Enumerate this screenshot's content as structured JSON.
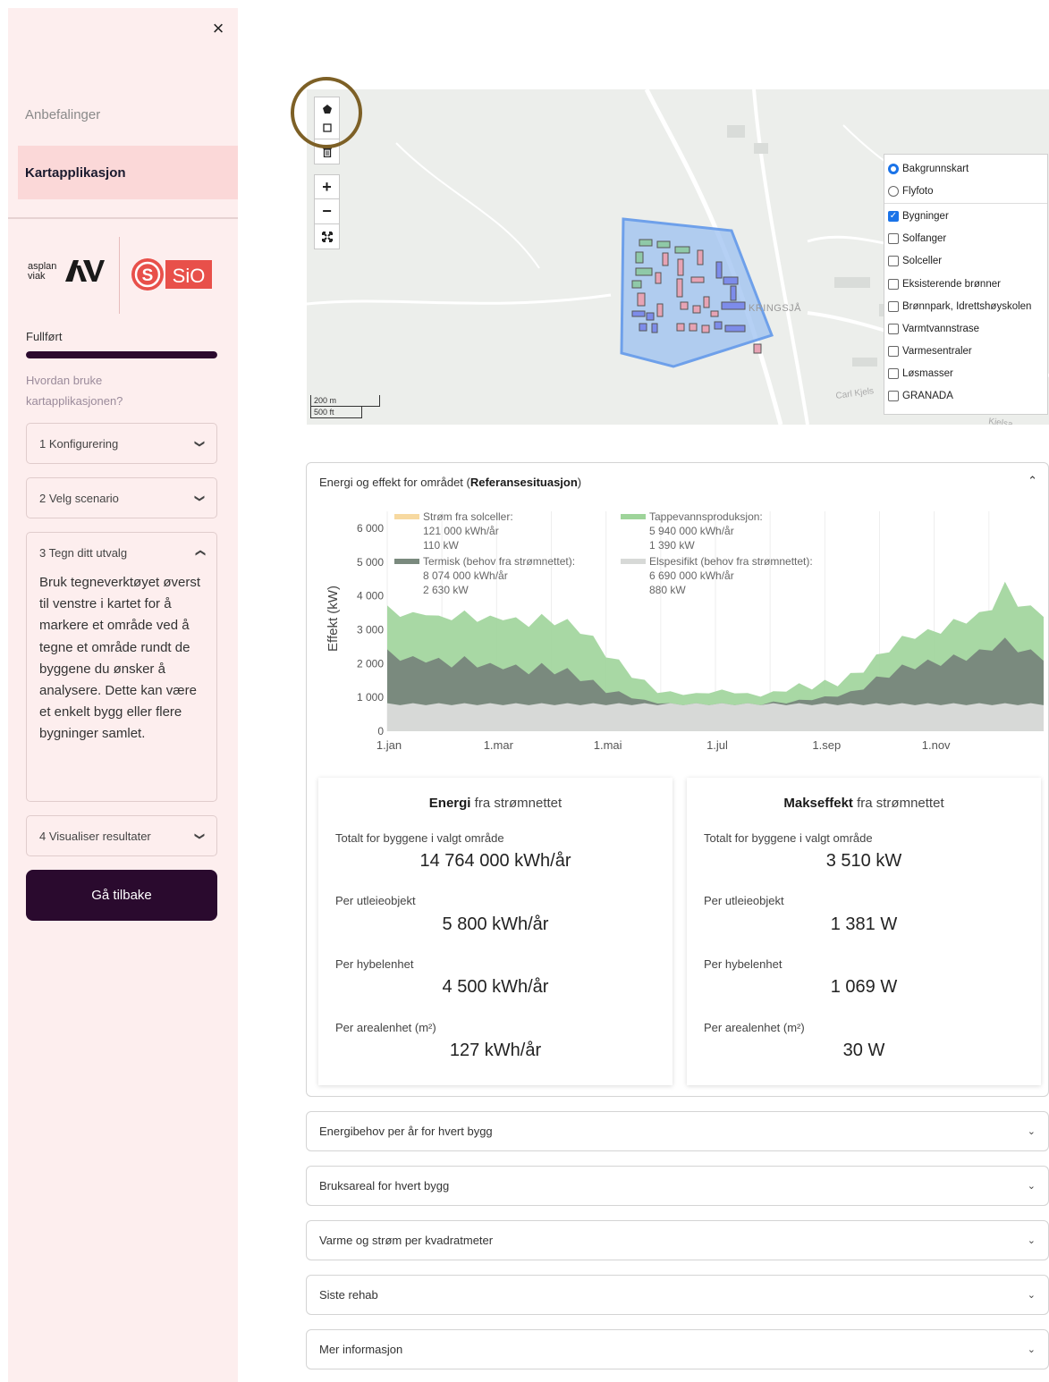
{
  "sidebar": {
    "close": "×",
    "nav": [
      "Anbefalinger",
      "Kartapplikasjon"
    ],
    "logos": {
      "asplan_top": "asplan",
      "asplan_bottom": "viak",
      "sio": "SiO"
    },
    "progress": {
      "label": "Fullført",
      "percent": 100
    },
    "help_link": "Hvordan bruke kartapplikasjonen?",
    "steps": [
      {
        "label": "1 Konfigurering",
        "expanded": false
      },
      {
        "label": "2 Velg scenario",
        "expanded": false
      },
      {
        "label": "3 Tegn ditt utvalg",
        "expanded": true,
        "body": "Bruk tegneverktøyet øverst til venstre i kartet for å markere et område ved å tegne et område rundt de byggene du ønsker å analysere. Dette kan være et enkelt bygg eller flere bygninger samlet."
      },
      {
        "label": "4 Visualiser resultater",
        "expanded": false
      }
    ],
    "back_button": "Gå tilbake"
  },
  "map": {
    "tools": [
      "polygon-draw-icon",
      "edit-icon",
      "trash-icon",
      "zoom-in",
      "zoom-out",
      "fullscreen-icon"
    ],
    "zoom_in": "+",
    "zoom_out": "−",
    "scale": {
      "metric": "200 m",
      "imperial": "500 ft"
    },
    "place_label": "KRINGSJÅ",
    "road_label": "Carl Kjels",
    "road_label2": "Kjelsa",
    "base_layers": [
      {
        "label": "Bakgrunnskart",
        "selected": true
      },
      {
        "label": "Flyfoto",
        "selected": false
      }
    ],
    "overlay_layers": [
      {
        "label": "Bygninger",
        "checked": true
      },
      {
        "label": "Solfanger",
        "checked": false
      },
      {
        "label": "Solceller",
        "checked": false
      },
      {
        "label": "Eksisterende brønner",
        "checked": false
      },
      {
        "label": "Brønnpark, Idrettshøyskolen",
        "checked": false
      },
      {
        "label": "Varmtvannstrase",
        "checked": false
      },
      {
        "label": "Varmesentraler",
        "checked": false
      },
      {
        "label": "Løsmasser",
        "checked": false
      },
      {
        "label": "GRANADA",
        "checked": false
      }
    ],
    "colors": {
      "area_fill": "#9cc0f0",
      "area_stroke": "#6ea0ea",
      "building_green": "#8fc9a8",
      "building_red": "#e7a3b4",
      "building_blue": "#7d8cea"
    }
  },
  "energy_panel": {
    "title_prefix": "Energi og effekt for området (",
    "title_bold": "Referansesituasjon",
    "title_suffix": ")",
    "chart_data": {
      "type": "area",
      "ylabel": "Effekt (kW)",
      "yticks": [
        "0",
        "1 000",
        "2 000",
        "3 000",
        "4 000",
        "5 000",
        "6 000"
      ],
      "ylim": [
        0,
        6500
      ],
      "xticks": [
        "1.jan",
        "1.mar",
        "1.mai",
        "1.jul",
        "1.sep",
        "1.nov"
      ],
      "legend": [
        {
          "name": "Strøm fra solceller:",
          "energy": "121 000 kWh/år",
          "peak": "110 kW",
          "color": "#f7d9a0"
        },
        {
          "name": "Tappevannsproduksjon:",
          "energy": "5 940 000 kWh/år",
          "peak": "1 390 kW",
          "color": "#9ed49a"
        },
        {
          "name": "Termisk (behov fra strømnettet):",
          "energy": "8 074 000 kWh/år",
          "peak": "2 630 kW",
          "color": "#7a8a7e"
        },
        {
          "name": "Elspesifikt (behov fra strømnettet):",
          "energy": "6 690 000 kWh/år",
          "peak": "880 kW",
          "color": "#d7d9d7"
        }
      ],
      "series": [
        {
          "name": "Elspesifikt (behov fra strømnettet):",
          "color": "#d7d9d7",
          "values": [
            800,
            800,
            800,
            800,
            800,
            800,
            800,
            800,
            800,
            800,
            800,
            800,
            800,
            800,
            800,
            800,
            800,
            800,
            800,
            800,
            800,
            800,
            800,
            800,
            800,
            800,
            800,
            800,
            800,
            800,
            800,
            800,
            800,
            800,
            800,
            800,
            800,
            800,
            800,
            800,
            800,
            800,
            800,
            800,
            800,
            800,
            800,
            800,
            800,
            800,
            800,
            800
          ]
        },
        {
          "name": "Termisk (behov fra strømnettet):",
          "color": "#7a8a7e",
          "values": [
            2300,
            2200,
            2100,
            2150,
            2050,
            2000,
            2100,
            2000,
            1900,
            1950,
            1850,
            1800,
            1900,
            1800,
            1750,
            1600,
            1400,
            1250,
            1150,
            1000,
            900,
            850,
            800,
            800,
            800,
            800,
            800,
            800,
            800,
            800,
            850,
            850,
            900,
            950,
            1000,
            1050,
            1150,
            1350,
            1500,
            1700,
            1850,
            1950,
            2000,
            2050,
            2150,
            2200,
            2300,
            2500,
            2650,
            2450,
            2300,
            2200
          ]
        },
        {
          "name": "Tappevannsproduksjon:",
          "color": "#9ed49a",
          "values": [
            3600,
            3500,
            3400,
            3550,
            3300,
            3400,
            3450,
            3350,
            3300,
            3400,
            3250,
            3200,
            3350,
            3250,
            3200,
            3000,
            2700,
            2300,
            2000,
            1700,
            1400,
            1250,
            1150,
            1100,
            1100,
            1150,
            1200,
            1150,
            1100,
            1050,
            1150,
            1200,
            1300,
            1350,
            1400,
            1450,
            1600,
            1850,
            2150,
            2450,
            2700,
            2850,
            2900,
            3000,
            3200,
            3300,
            3400,
            3700,
            4300,
            3800,
            3600,
            3500
          ]
        },
        {
          "name": "Strøm fra solceller:",
          "color": "#f7d9a0",
          "values": [
            0,
            0,
            0,
            0,
            0,
            0,
            0,
            0,
            0,
            0,
            0,
            0,
            0,
            0,
            0,
            0,
            0,
            0,
            0,
            0,
            0,
            0,
            0,
            0,
            0,
            0,
            0,
            0,
            0,
            0,
            0,
            0,
            0,
            0,
            0,
            0,
            0,
            0,
            0,
            0,
            0,
            0,
            0,
            0,
            0,
            0,
            0,
            0,
            0,
            0,
            0,
            0
          ]
        }
      ]
    },
    "cards": [
      {
        "title_bold": "Energi",
        "title_rest": " fra strømnettet",
        "stats": [
          {
            "label": "Totalt for byggene i valgt område",
            "value": "14 764 000 kWh/år"
          },
          {
            "label": "Per utleieobjekt",
            "value": "5 800 kWh/år"
          },
          {
            "label": "Per hybelenhet",
            "value": "4 500 kWh/år"
          },
          {
            "label": "Per arealenhet (m²)",
            "value": "127 kWh/år"
          }
        ]
      },
      {
        "title_bold": "Makseffekt",
        "title_rest": " fra strømnettet",
        "stats": [
          {
            "label": "Totalt for byggene i valgt område",
            "value": "3 510 kW"
          },
          {
            "label": "Per utleieobjekt",
            "value": "1 381 W"
          },
          {
            "label": "Per hybelenhet",
            "value": "1 069 W"
          },
          {
            "label": "Per arealenhet (m²)",
            "value": "30 W"
          }
        ]
      }
    ]
  },
  "sections": [
    "Energibehov per år for hvert bygg",
    "Bruksareal for hvert bygg",
    "Varme og strøm per kvadratmeter",
    "Siste rehab",
    "Mer informasjon"
  ]
}
